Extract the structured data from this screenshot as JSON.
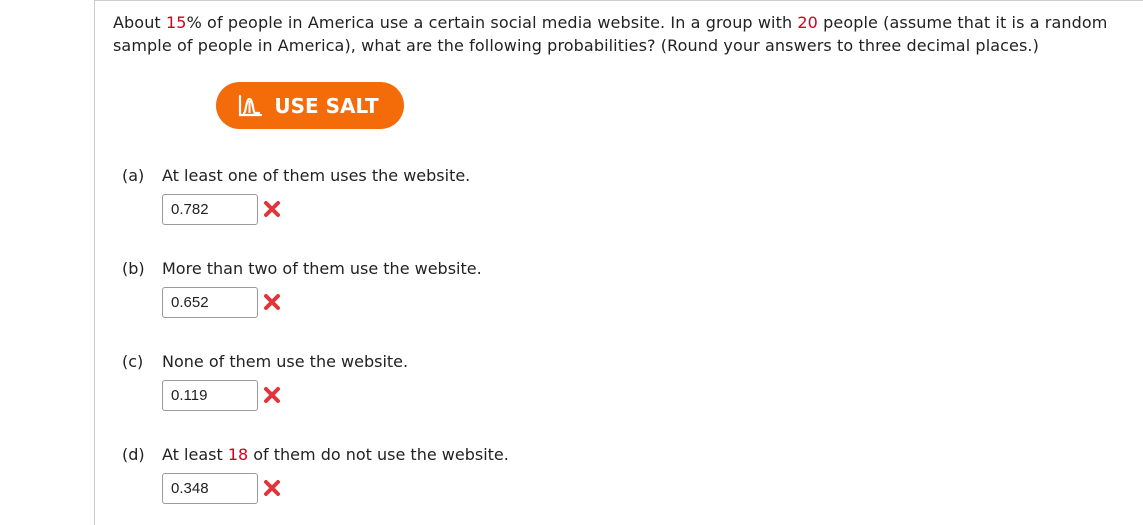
{
  "question": {
    "t1": "About ",
    "percent": "15",
    "t2": "% of people in America use a certain social media website. In a group with ",
    "group_size": "20",
    "t3": " people (assume that it is a random sample of people in America), what are the following probabilities? (Round your answers to three decimal places.)"
  },
  "salt_button": {
    "label": "USE SALT",
    "icon": "salt-distribution-icon",
    "color": "#f46b0a"
  },
  "parts": {
    "a": {
      "letter": "(a)",
      "text": "At least one of them uses the website.",
      "answer": "0.782",
      "status_icon": "incorrect-x-icon"
    },
    "b": {
      "letter": "(b)",
      "text": "More than two of them use the website.",
      "answer": "0.652",
      "status_icon": "incorrect-x-icon"
    },
    "c": {
      "letter": "(c)",
      "text": "None of them use the website.",
      "answer": "0.119",
      "status_icon": "incorrect-x-icon"
    },
    "d": {
      "letter": "(d)",
      "text_before": "At least ",
      "count": "18",
      "text_after": " of them do not use the website.",
      "answer": "0.348",
      "status_icon": "incorrect-x-icon"
    }
  },
  "colors": {
    "highlight": "#d0021b",
    "incorrect": "#e0363b"
  }
}
